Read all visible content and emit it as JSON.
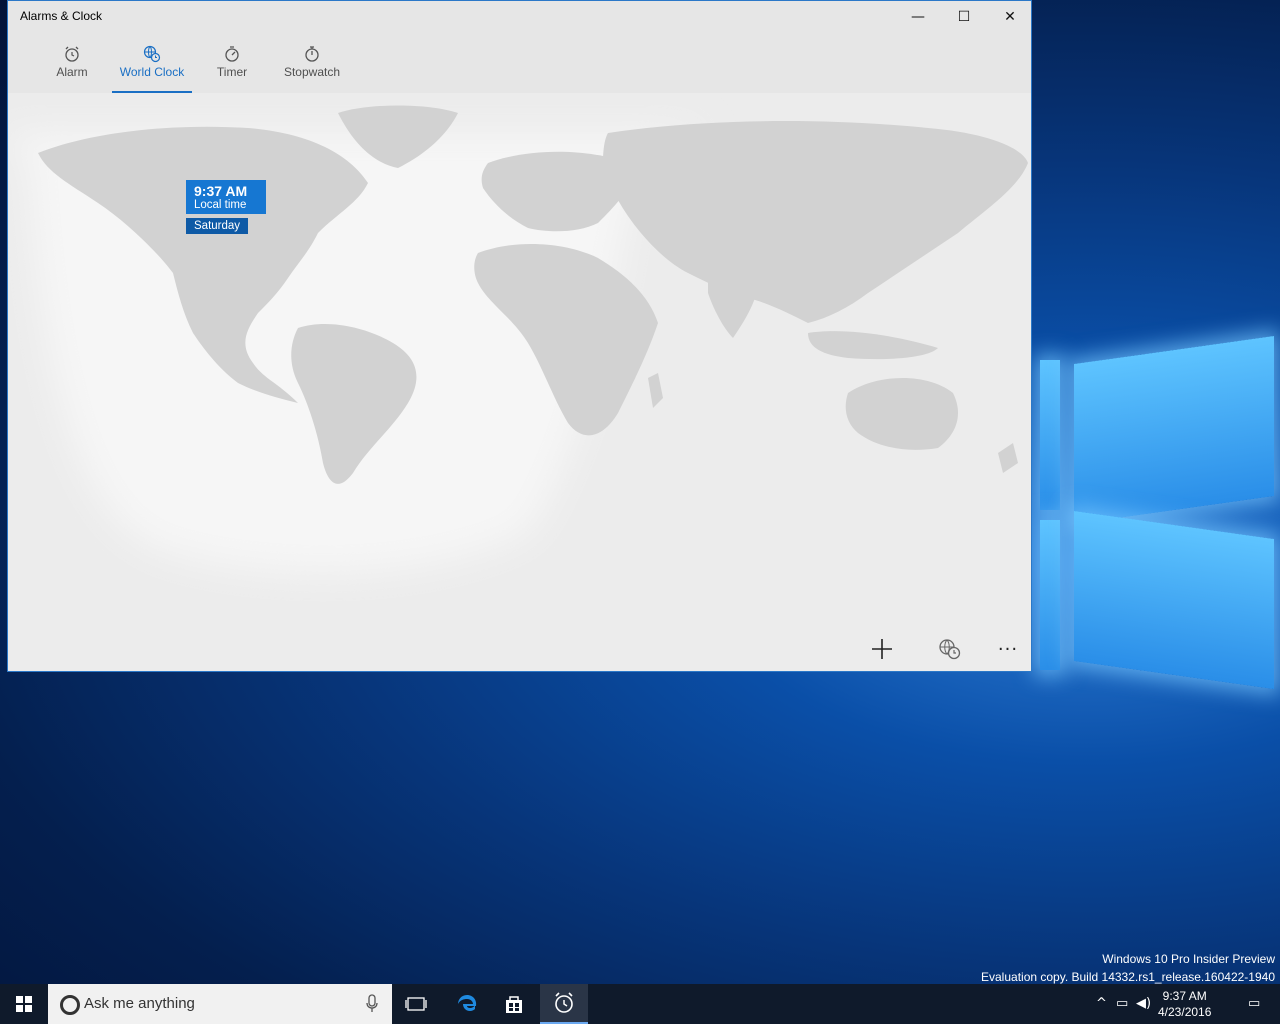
{
  "window": {
    "title": "Alarms & Clock",
    "controls": {
      "minimize": "—",
      "maximize": "☐",
      "close": "✕"
    }
  },
  "tabs": [
    {
      "label": "Alarm",
      "icon": "alarm-icon"
    },
    {
      "label": "World Clock",
      "icon": "globe-clock-icon",
      "active": true
    },
    {
      "label": "Timer",
      "icon": "timer-icon"
    },
    {
      "label": "Stopwatch",
      "icon": "stopwatch-icon"
    }
  ],
  "clock_card": {
    "time": "9:37 AM",
    "label": "Local time",
    "day": "Saturday"
  },
  "commands": {
    "more": "···"
  },
  "watermark": {
    "line1": "Windows 10 Pro Insider Preview",
    "line2": "Evaluation copy. Build 14332.rs1_release.160422-1940"
  },
  "taskbar": {
    "search_placeholder": "Ask me anything",
    "clock_time": "9:37 AM",
    "clock_date": "4/23/2016"
  },
  "colors": {
    "accent": "#1677d2",
    "accent_dark": "#0e5aa6",
    "taskbar": "#0f1a2b"
  }
}
